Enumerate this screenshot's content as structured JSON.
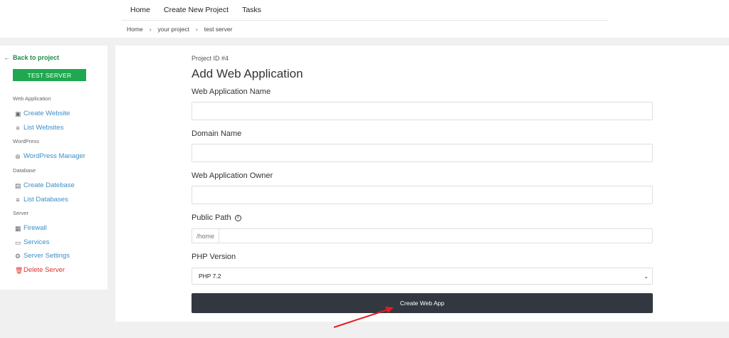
{
  "topnav": {
    "items": [
      {
        "label": "Home"
      },
      {
        "label": "Create New Project"
      },
      {
        "label": "Tasks"
      }
    ]
  },
  "breadcrumb": {
    "items": [
      "Home",
      "your project",
      "test server"
    ],
    "separator": "›"
  },
  "sidebar": {
    "back_label": "Back to project",
    "server_button": "TEST SERVER",
    "sections": [
      {
        "title": "Web Application",
        "items": [
          {
            "label": "Create Website",
            "icon": "website-icon"
          },
          {
            "label": "List Websites",
            "icon": "list-icon"
          }
        ]
      },
      {
        "title": "WordPress",
        "items": [
          {
            "label": "WordPress Manager",
            "icon": "wordpress-icon"
          }
        ]
      },
      {
        "title": "Database",
        "items": [
          {
            "label": "Create Datebase",
            "icon": "database-icon"
          },
          {
            "label": "List Databases",
            "icon": "list-icon"
          }
        ]
      },
      {
        "title": "Server",
        "items": [
          {
            "label": "Firewall",
            "icon": "firewall-icon"
          },
          {
            "label": "Services",
            "icon": "services-icon"
          },
          {
            "label": "Server Settings",
            "icon": "gear-icon"
          },
          {
            "label": "Delete Server",
            "icon": "trash-icon"
          }
        ]
      }
    ]
  },
  "form": {
    "project_id": "Project ID #4",
    "title": "Add Web Application",
    "app_name_label": "Web Application Name",
    "app_name_value": "",
    "domain_label": "Domain Name",
    "domain_value": "",
    "owner_label": "Web Application Owner",
    "owner_value": "",
    "public_path_label": "Public Path",
    "public_path_prefix": "/home",
    "public_path_value": "",
    "php_label": "PHP Version",
    "php_value": "PHP 7.2",
    "submit_label": "Create Web App"
  },
  "colors": {
    "accent_green": "#1fa84f",
    "link_blue": "#3a8fc7",
    "danger_red": "#e0302c",
    "button_dark": "#333840",
    "annotation_arrow": "#e02020"
  }
}
